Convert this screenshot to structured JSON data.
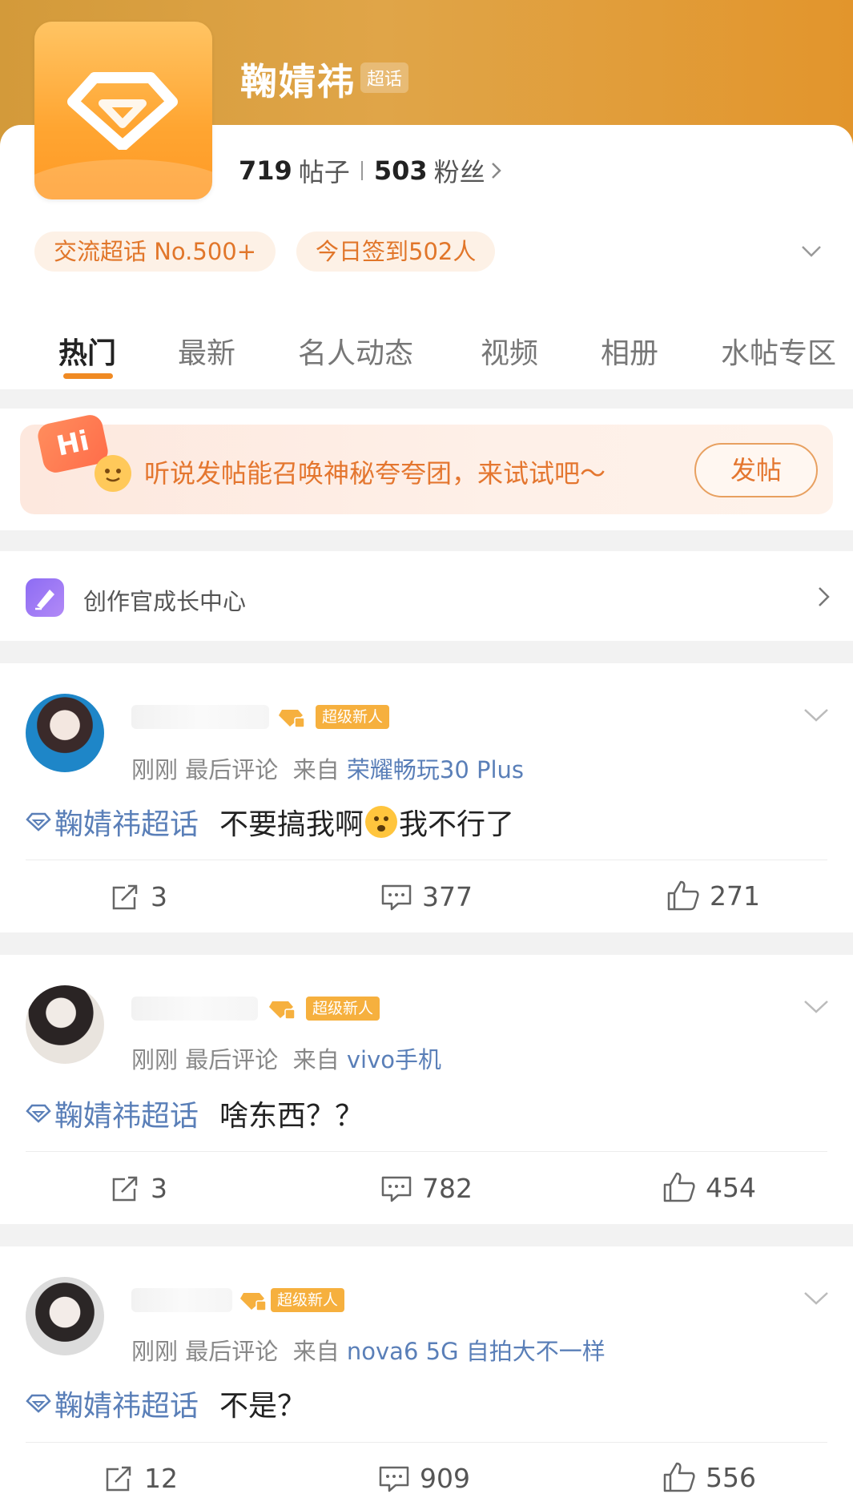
{
  "header": {
    "title": "鞠婧祎",
    "title_tag": "超话",
    "posts_count": "719",
    "posts_label": "帖子",
    "fans_count": "503",
    "fans_label": "粉丝",
    "pills": [
      "交流超话 No.500+",
      "今日签到502人"
    ]
  },
  "tabs": [
    "热门",
    "最新",
    "名人动态",
    "视频",
    "相册",
    "水帖专区"
  ],
  "active_tab": "热门",
  "banner": {
    "hi": "Hi",
    "text": "听说发帖能召唤神秘夸夸团，来试试吧～",
    "button": "发帖"
  },
  "creator": {
    "label": "创作官成长中心"
  },
  "posts": [
    {
      "badge": "超级新人",
      "time": "刚刚 最后评论",
      "from_label": "来自",
      "source": "荣耀畅玩30 Plus",
      "topic": "鞠婧祎超话",
      "text_before": "不要搞我啊",
      "text_after": "我不行了",
      "reposts": "3",
      "comments": "377",
      "likes": "271"
    },
    {
      "badge": "超级新人",
      "time": "刚刚 最后评论",
      "from_label": "来自",
      "source": "vivo手机",
      "topic": "鞠婧祎超话",
      "text_before": "啥东西？？",
      "text_after": "",
      "reposts": "3",
      "comments": "782",
      "likes": "454"
    },
    {
      "badge": "超级新人",
      "time": "刚刚 最后评论",
      "from_label": "来自",
      "source": "nova6 5G 自拍大不一样",
      "topic": "鞠婧祎超话",
      "text_before": "不是？",
      "text_after": "",
      "reposts": "12",
      "comments": "909",
      "likes": "556"
    }
  ],
  "colors": {
    "header_orange": "#e0a548",
    "accent": "#f08a23",
    "link_blue": "#5a7fb8",
    "badge_gold": "#f6b03e"
  }
}
